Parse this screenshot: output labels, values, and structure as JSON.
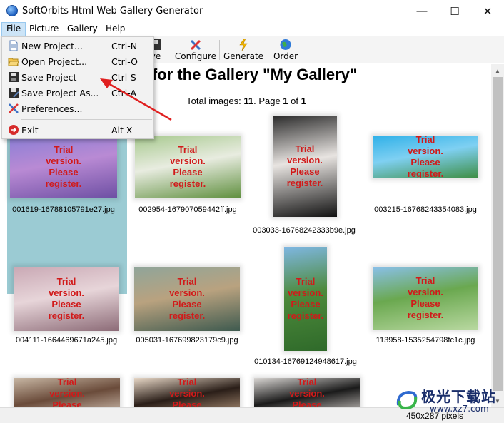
{
  "window": {
    "title": "SoftOrbits Html Web Gallery Generator",
    "minimize_glyph": "—",
    "maximize_glyph": "☐",
    "close_glyph": "✕"
  },
  "menubar": {
    "file": "File",
    "picture": "Picture",
    "gallery": "Gallery",
    "help": "Help"
  },
  "toolbar": {
    "save_partial": "ve",
    "configure": "Configure",
    "generate": "Generate",
    "order": "Order"
  },
  "file_menu": {
    "items": [
      {
        "label": "New Project...",
        "shortcut": "Ctrl-N",
        "icon": "new-document-icon"
      },
      {
        "label": "Open Project...",
        "shortcut": "Ctrl-O",
        "icon": "open-folder-icon"
      },
      {
        "label": "Save Project",
        "shortcut": "Ctrl-S",
        "icon": "floppy-disk-icon"
      },
      {
        "label": "Save Project As...",
        "shortcut": "Ctrl-A",
        "icon": "save-as-icon"
      },
      {
        "label": "Preferences...",
        "shortcut": "",
        "icon": "wrench-icon"
      },
      {
        "label": "Exit",
        "shortcut": "Alt-X",
        "icon": "exit-icon"
      }
    ]
  },
  "content": {
    "title_visible": "w for the Gallery \"My Gallery\"",
    "total_prefix": "Total images: ",
    "total_count": "11",
    "page_sep": ". Page ",
    "page_current": "1",
    "page_of": " of ",
    "page_total": "1",
    "watermark_lines": [
      "Trial",
      "version.",
      "Please",
      "register."
    ],
    "images": [
      {
        "filename": "001619-16788105791e27.jpg",
        "selected": true,
        "colors": [
          "#8a7fd6",
          "#b98ad4",
          "#6d4fa3"
        ]
      },
      {
        "filename": "002954-167907059442ff.jpg",
        "selected": false,
        "colors": [
          "#a7c98e",
          "#e8ece0",
          "#5f8f3e"
        ]
      },
      {
        "filename": "003033-16768242333b9e.jpg",
        "selected": false,
        "colors": [
          "#2b2b2b",
          "#e8e4e1",
          "#111111"
        ]
      },
      {
        "filename": "003215-16768243354083.jpg",
        "selected": false,
        "colors": [
          "#2fb0e8",
          "#7fd0f2",
          "#3d8d42"
        ]
      },
      {
        "filename": "004111-1664469671a245.jpg",
        "selected": false,
        "colors": [
          "#c9a8b4",
          "#e7d5d9",
          "#8c6b77"
        ]
      },
      {
        "filename": "005031-167699823179c9.jpg",
        "selected": false,
        "colors": [
          "#8fa59a",
          "#b9a27f",
          "#3e5a4f"
        ]
      },
      {
        "filename": "010134-16769124948617.jpg",
        "selected": false,
        "colors": [
          "#7fb7e2",
          "#4d8a3b",
          "#2f6a2a"
        ]
      },
      {
        "filename": "113958-1535254798fc1c.jpg",
        "selected": false,
        "colors": [
          "#8ac0ea",
          "#6aa84f",
          "#b8d8a0"
        ]
      },
      {
        "filename": "",
        "selected": false,
        "colors": [
          "#c7b6a3",
          "#6a4b3a",
          "#e3d6c8"
        ]
      },
      {
        "filename": "",
        "selected": false,
        "colors": [
          "#e7d7c6",
          "#2a1e18",
          "#c9a98b"
        ]
      },
      {
        "filename": "",
        "selected": false,
        "colors": [
          "#d9d6d3",
          "#1a1a1a",
          "#efe9e4"
        ]
      }
    ]
  },
  "statusbar": {
    "dimensions": "450x287 pixels"
  },
  "site_watermark": {
    "title": "极光下载站",
    "url": "www.xz7.com"
  },
  "colors": {
    "menu_highlight": "#cce4f7",
    "selection": "#9bcbd3",
    "watermark_red": "#d11a1a",
    "arrow_red": "#e02020"
  }
}
